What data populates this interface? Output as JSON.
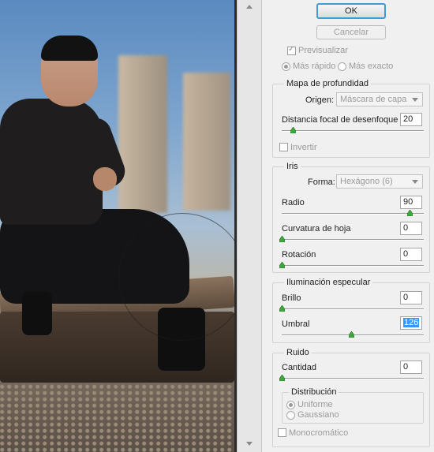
{
  "buttons": {
    "ok": "OK",
    "cancel": "Cancelar"
  },
  "preview_options": {
    "preview_label": "Previsualizar",
    "faster_label": "Más rápido",
    "exact_label": "Más exacto"
  },
  "depth_map": {
    "title": "Mapa de profundidad",
    "source_label": "Origen:",
    "source_value": "Máscara de capa",
    "blur_focal_label": "Distancia focal de desenfoque",
    "blur_focal_value": "20",
    "blur_focal_fraction": 0.08,
    "invert_label": "Invertir"
  },
  "iris": {
    "title": "Iris",
    "shape_label": "Forma:",
    "shape_value": "Hexágono (6)",
    "radius_label": "Radio",
    "radius_value": "90",
    "radius_fraction": 0.9,
    "curvature_label": "Curvatura de hoja",
    "curvature_value": "0",
    "curvature_fraction": 0.0,
    "rotation_label": "Rotación",
    "rotation_value": "0",
    "rotation_fraction": 0.0
  },
  "specular": {
    "title": "Iluminación especular",
    "brightness_label": "Brillo",
    "brightness_value": "0",
    "brightness_fraction": 0.0,
    "threshold_label": "Umbral",
    "threshold_value": "126",
    "threshold_fraction": 0.49
  },
  "noise": {
    "title": "Ruido",
    "amount_label": "Cantidad",
    "amount_value": "0",
    "amount_fraction": 0.0,
    "distribution_title": "Distribución",
    "uniform_label": "Uniforme",
    "gaussian_label": "Gaussiano",
    "monochrome_label": "Monocromático"
  },
  "colors": {
    "accent": "#3c9bd8",
    "selection": "#3399ff",
    "thumb": "#3aa83a"
  }
}
